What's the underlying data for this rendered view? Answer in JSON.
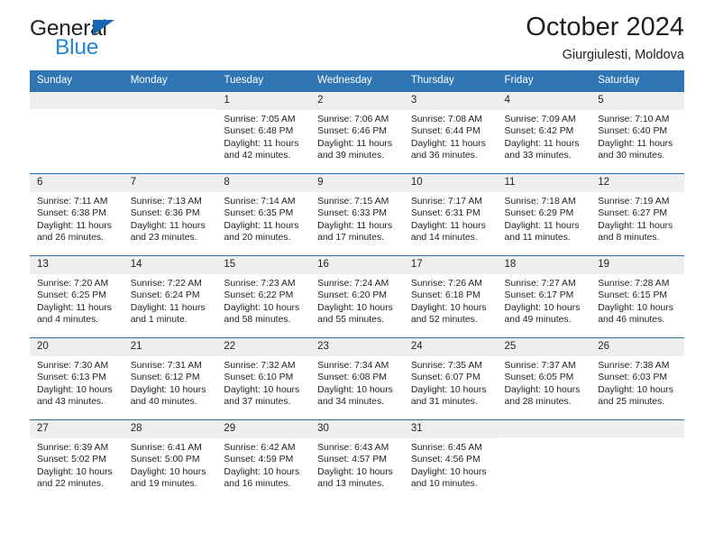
{
  "brand": {
    "name_top": "General",
    "name_bottom": "Blue",
    "triangle_color": "#1567b2",
    "blue_color": "#1f86d4"
  },
  "header": {
    "title": "October 2024",
    "subtitle": "Giurgiulesti, Moldova"
  },
  "theme": {
    "header_bar": "#3075b4",
    "row_rule": "#2b6cab",
    "daynum_band": "#efefef",
    "text": "#231f20"
  },
  "calendar": {
    "weekday_headers": [
      "Sunday",
      "Monday",
      "Tuesday",
      "Wednesday",
      "Thursday",
      "Friday",
      "Saturday"
    ],
    "labels": {
      "sunrise": "Sunrise:",
      "sunset": "Sunset:",
      "daylight": "Daylight:"
    },
    "weeks": [
      [
        {
          "day": "",
          "empty": true
        },
        {
          "day": "",
          "empty": true
        },
        {
          "day": "1",
          "sunrise": "Sunrise: 7:05 AM",
          "sunset": "Sunset: 6:48 PM",
          "daylight_a": "Daylight: 11 hours",
          "daylight_b": "and 42 minutes."
        },
        {
          "day": "2",
          "sunrise": "Sunrise: 7:06 AM",
          "sunset": "Sunset: 6:46 PM",
          "daylight_a": "Daylight: 11 hours",
          "daylight_b": "and 39 minutes."
        },
        {
          "day": "3",
          "sunrise": "Sunrise: 7:08 AM",
          "sunset": "Sunset: 6:44 PM",
          "daylight_a": "Daylight: 11 hours",
          "daylight_b": "and 36 minutes."
        },
        {
          "day": "4",
          "sunrise": "Sunrise: 7:09 AM",
          "sunset": "Sunset: 6:42 PM",
          "daylight_a": "Daylight: 11 hours",
          "daylight_b": "and 33 minutes."
        },
        {
          "day": "5",
          "sunrise": "Sunrise: 7:10 AM",
          "sunset": "Sunset: 6:40 PM",
          "daylight_a": "Daylight: 11 hours",
          "daylight_b": "and 30 minutes."
        }
      ],
      [
        {
          "day": "6",
          "sunrise": "Sunrise: 7:11 AM",
          "sunset": "Sunset: 6:38 PM",
          "daylight_a": "Daylight: 11 hours",
          "daylight_b": "and 26 minutes."
        },
        {
          "day": "7",
          "sunrise": "Sunrise: 7:13 AM",
          "sunset": "Sunset: 6:36 PM",
          "daylight_a": "Daylight: 11 hours",
          "daylight_b": "and 23 minutes."
        },
        {
          "day": "8",
          "sunrise": "Sunrise: 7:14 AM",
          "sunset": "Sunset: 6:35 PM",
          "daylight_a": "Daylight: 11 hours",
          "daylight_b": "and 20 minutes."
        },
        {
          "day": "9",
          "sunrise": "Sunrise: 7:15 AM",
          "sunset": "Sunset: 6:33 PM",
          "daylight_a": "Daylight: 11 hours",
          "daylight_b": "and 17 minutes."
        },
        {
          "day": "10",
          "sunrise": "Sunrise: 7:17 AM",
          "sunset": "Sunset: 6:31 PM",
          "daylight_a": "Daylight: 11 hours",
          "daylight_b": "and 14 minutes."
        },
        {
          "day": "11",
          "sunrise": "Sunrise: 7:18 AM",
          "sunset": "Sunset: 6:29 PM",
          "daylight_a": "Daylight: 11 hours",
          "daylight_b": "and 11 minutes."
        },
        {
          "day": "12",
          "sunrise": "Sunrise: 7:19 AM",
          "sunset": "Sunset: 6:27 PM",
          "daylight_a": "Daylight: 11 hours",
          "daylight_b": "and 8 minutes."
        }
      ],
      [
        {
          "day": "13",
          "sunrise": "Sunrise: 7:20 AM",
          "sunset": "Sunset: 6:25 PM",
          "daylight_a": "Daylight: 11 hours",
          "daylight_b": "and 4 minutes."
        },
        {
          "day": "14",
          "sunrise": "Sunrise: 7:22 AM",
          "sunset": "Sunset: 6:24 PM",
          "daylight_a": "Daylight: 11 hours",
          "daylight_b": "and 1 minute."
        },
        {
          "day": "15",
          "sunrise": "Sunrise: 7:23 AM",
          "sunset": "Sunset: 6:22 PM",
          "daylight_a": "Daylight: 10 hours",
          "daylight_b": "and 58 minutes."
        },
        {
          "day": "16",
          "sunrise": "Sunrise: 7:24 AM",
          "sunset": "Sunset: 6:20 PM",
          "daylight_a": "Daylight: 10 hours",
          "daylight_b": "and 55 minutes."
        },
        {
          "day": "17",
          "sunrise": "Sunrise: 7:26 AM",
          "sunset": "Sunset: 6:18 PM",
          "daylight_a": "Daylight: 10 hours",
          "daylight_b": "and 52 minutes."
        },
        {
          "day": "18",
          "sunrise": "Sunrise: 7:27 AM",
          "sunset": "Sunset: 6:17 PM",
          "daylight_a": "Daylight: 10 hours",
          "daylight_b": "and 49 minutes."
        },
        {
          "day": "19",
          "sunrise": "Sunrise: 7:28 AM",
          "sunset": "Sunset: 6:15 PM",
          "daylight_a": "Daylight: 10 hours",
          "daylight_b": "and 46 minutes."
        }
      ],
      [
        {
          "day": "20",
          "sunrise": "Sunrise: 7:30 AM",
          "sunset": "Sunset: 6:13 PM",
          "daylight_a": "Daylight: 10 hours",
          "daylight_b": "and 43 minutes."
        },
        {
          "day": "21",
          "sunrise": "Sunrise: 7:31 AM",
          "sunset": "Sunset: 6:12 PM",
          "daylight_a": "Daylight: 10 hours",
          "daylight_b": "and 40 minutes."
        },
        {
          "day": "22",
          "sunrise": "Sunrise: 7:32 AM",
          "sunset": "Sunset: 6:10 PM",
          "daylight_a": "Daylight: 10 hours",
          "daylight_b": "and 37 minutes."
        },
        {
          "day": "23",
          "sunrise": "Sunrise: 7:34 AM",
          "sunset": "Sunset: 6:08 PM",
          "daylight_a": "Daylight: 10 hours",
          "daylight_b": "and 34 minutes."
        },
        {
          "day": "24",
          "sunrise": "Sunrise: 7:35 AM",
          "sunset": "Sunset: 6:07 PM",
          "daylight_a": "Daylight: 10 hours",
          "daylight_b": "and 31 minutes."
        },
        {
          "day": "25",
          "sunrise": "Sunrise: 7:37 AM",
          "sunset": "Sunset: 6:05 PM",
          "daylight_a": "Daylight: 10 hours",
          "daylight_b": "and 28 minutes."
        },
        {
          "day": "26",
          "sunrise": "Sunrise: 7:38 AM",
          "sunset": "Sunset: 6:03 PM",
          "daylight_a": "Daylight: 10 hours",
          "daylight_b": "and 25 minutes."
        }
      ],
      [
        {
          "day": "27",
          "sunrise": "Sunrise: 6:39 AM",
          "sunset": "Sunset: 5:02 PM",
          "daylight_a": "Daylight: 10 hours",
          "daylight_b": "and 22 minutes."
        },
        {
          "day": "28",
          "sunrise": "Sunrise: 6:41 AM",
          "sunset": "Sunset: 5:00 PM",
          "daylight_a": "Daylight: 10 hours",
          "daylight_b": "and 19 minutes."
        },
        {
          "day": "29",
          "sunrise": "Sunrise: 6:42 AM",
          "sunset": "Sunset: 4:59 PM",
          "daylight_a": "Daylight: 10 hours",
          "daylight_b": "and 16 minutes."
        },
        {
          "day": "30",
          "sunrise": "Sunrise: 6:43 AM",
          "sunset": "Sunset: 4:57 PM",
          "daylight_a": "Daylight: 10 hours",
          "daylight_b": "and 13 minutes."
        },
        {
          "day": "31",
          "sunrise": "Sunrise: 6:45 AM",
          "sunset": "Sunset: 4:56 PM",
          "daylight_a": "Daylight: 10 hours",
          "daylight_b": "and 10 minutes."
        },
        {
          "day": "",
          "empty": true
        },
        {
          "day": "",
          "empty": true
        }
      ]
    ]
  }
}
